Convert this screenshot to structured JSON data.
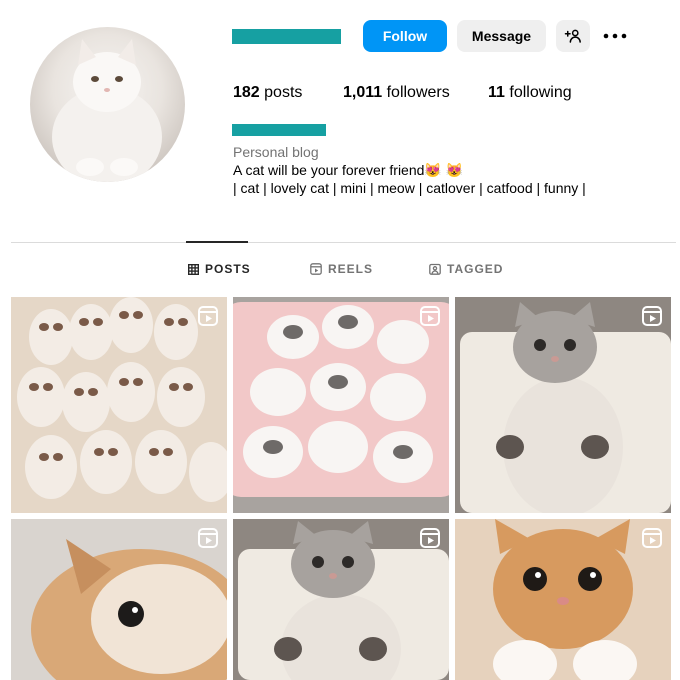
{
  "header": {
    "follow_label": "Follow",
    "message_label": "Message",
    "add_user_icon": "person-add-icon",
    "more_icon": "more-horizontal-icon"
  },
  "stats": {
    "posts_count": "182",
    "posts_label": " posts",
    "followers_count": "1,011",
    "followers_label": " followers",
    "following_count": "11",
    "following_label": " following"
  },
  "bio": {
    "category": "Personal blog",
    "line1": "A cat will be your forever friend😻 😻",
    "line2": "| cat | lovely cat | mini | meow | catlover | catfood | funny |"
  },
  "tabs": [
    {
      "label": "POSTS",
      "icon": "grid-icon",
      "active": true
    },
    {
      "label": "REELS",
      "icon": "reels-icon",
      "active": false
    },
    {
      "label": "TAGGED",
      "icon": "tagged-icon",
      "active": false
    }
  ],
  "colors": {
    "accent": "#0095f6",
    "redaction": "#16a0a2",
    "secondary_button": "#efefef"
  }
}
